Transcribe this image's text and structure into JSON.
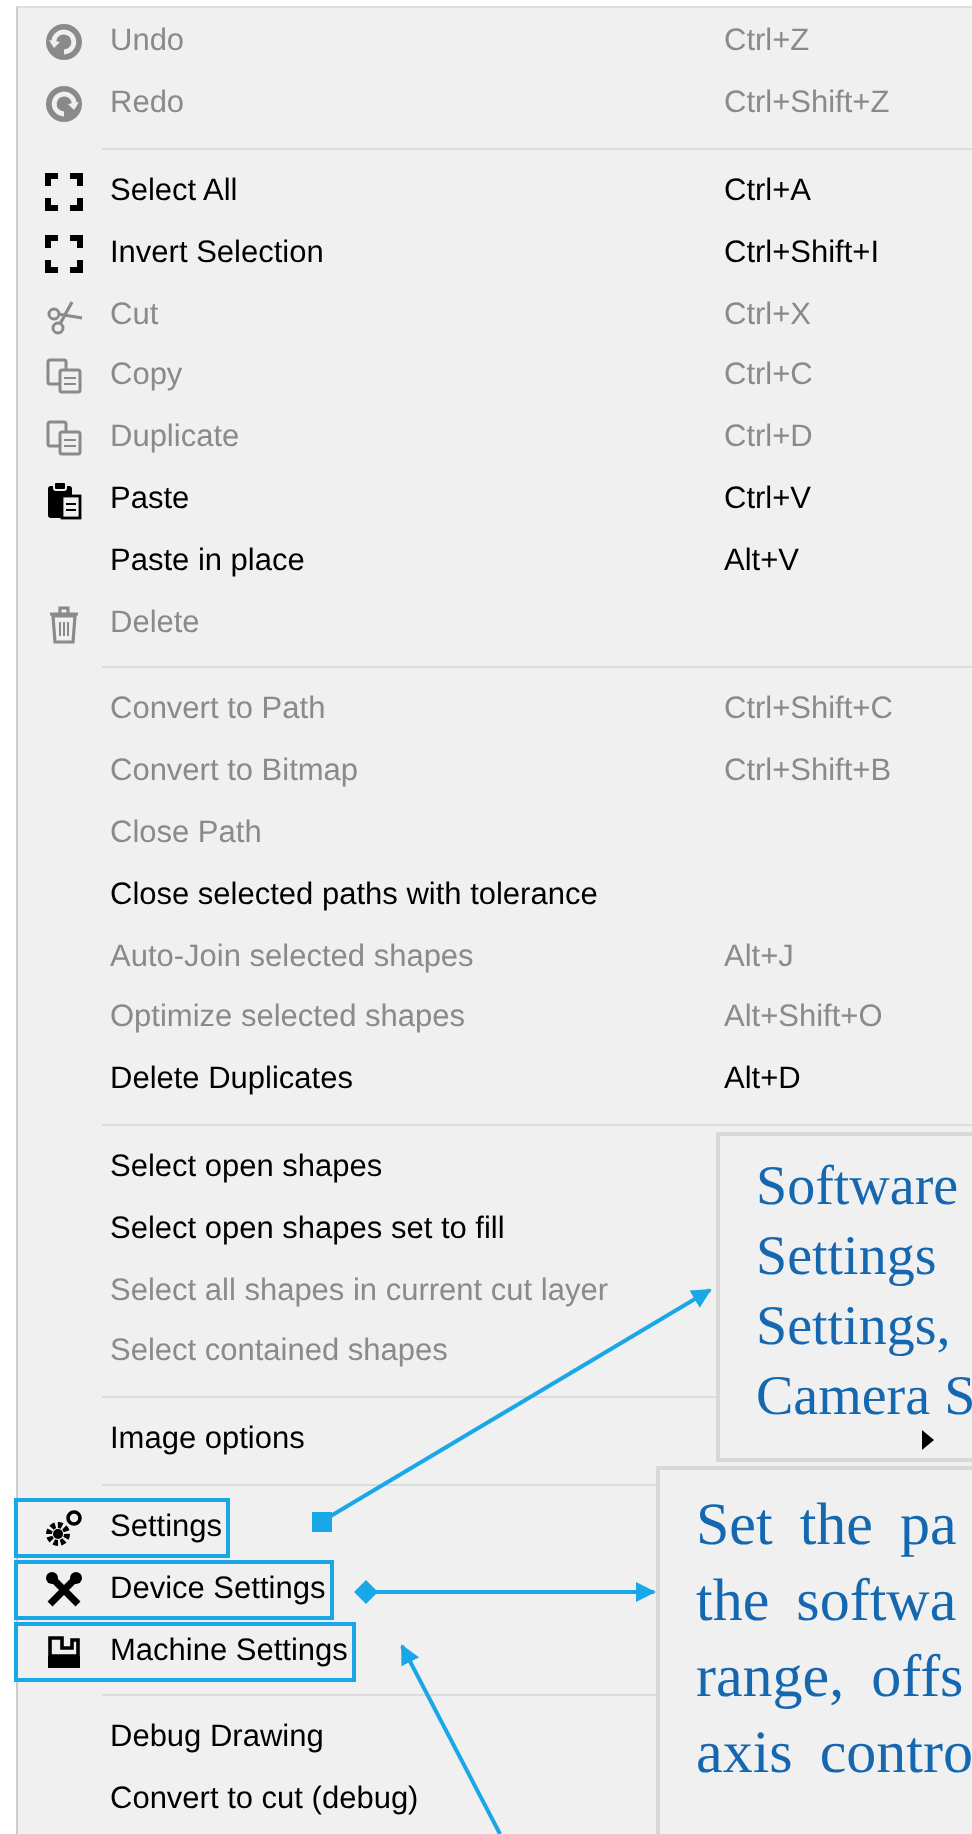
{
  "menu": {
    "items": [
      {
        "kind": "item",
        "label": "Undo",
        "shortcut": "Ctrl+Z",
        "disabled": true,
        "highlighted": false,
        "submenu": false
      },
      {
        "kind": "item",
        "label": "Redo",
        "shortcut": "Ctrl+Shift+Z",
        "disabled": true,
        "highlighted": false,
        "submenu": false
      },
      {
        "kind": "separator"
      },
      {
        "kind": "item",
        "label": "Select All",
        "shortcut": "Ctrl+A",
        "disabled": false,
        "highlighted": false,
        "submenu": false
      },
      {
        "kind": "item",
        "label": "Invert Selection",
        "shortcut": "Ctrl+Shift+I",
        "disabled": false,
        "highlighted": false,
        "submenu": false
      },
      {
        "kind": "item",
        "label": "Cut",
        "shortcut": "Ctrl+X",
        "disabled": true,
        "highlighted": false,
        "submenu": false
      },
      {
        "kind": "item",
        "label": "Copy",
        "shortcut": "Ctrl+C",
        "disabled": true,
        "highlighted": false,
        "submenu": false
      },
      {
        "kind": "item",
        "label": "Duplicate",
        "shortcut": "Ctrl+D",
        "disabled": true,
        "highlighted": false,
        "submenu": false
      },
      {
        "kind": "item",
        "label": "Paste",
        "shortcut": "Ctrl+V",
        "disabled": false,
        "highlighted": false,
        "submenu": false
      },
      {
        "kind": "item",
        "label": "Paste in place",
        "shortcut": "Alt+V",
        "disabled": false,
        "highlighted": false,
        "submenu": false
      },
      {
        "kind": "item",
        "label": "Delete",
        "disabled": true,
        "highlighted": false,
        "submenu": false
      },
      {
        "kind": "separator"
      },
      {
        "kind": "item",
        "label": "Convert to Path",
        "shortcut": "Ctrl+Shift+C",
        "disabled": true,
        "highlighted": false,
        "submenu": false
      },
      {
        "kind": "item",
        "label": "Convert to Bitmap",
        "shortcut": "Ctrl+Shift+B",
        "disabled": true,
        "highlighted": false,
        "submenu": false
      },
      {
        "kind": "item",
        "label": "Close Path",
        "disabled": true,
        "highlighted": false,
        "submenu": false
      },
      {
        "kind": "item",
        "label": "Close selected paths with tolerance",
        "disabled": false,
        "highlighted": false,
        "submenu": false
      },
      {
        "kind": "item",
        "label": "Auto-Join selected shapes",
        "shortcut": "Alt+J",
        "disabled": true,
        "highlighted": false,
        "submenu": false
      },
      {
        "kind": "item",
        "label": "Optimize selected shapes",
        "shortcut": "Alt+Shift+O",
        "disabled": true,
        "highlighted": false,
        "submenu": false
      },
      {
        "kind": "item",
        "label": "Delete Duplicates",
        "shortcut": "Alt+D",
        "disabled": false,
        "highlighted": false,
        "submenu": false
      },
      {
        "kind": "separator"
      },
      {
        "kind": "item",
        "label": "Select open shapes",
        "disabled": false,
        "highlighted": false,
        "submenu": false
      },
      {
        "kind": "item",
        "label": "Select open shapes set to fill",
        "disabled": false,
        "highlighted": false,
        "submenu": false
      },
      {
        "kind": "item",
        "label": "Select all shapes in current cut layer",
        "disabled": true,
        "highlighted": false,
        "submenu": false
      },
      {
        "kind": "item",
        "label": "Select contained shapes",
        "disabled": true,
        "highlighted": false,
        "submenu": false
      },
      {
        "kind": "separator"
      },
      {
        "kind": "item",
        "label": "Image options",
        "disabled": false,
        "highlighted": false,
        "submenu": true
      },
      {
        "kind": "separator"
      },
      {
        "kind": "item",
        "label": "Settings",
        "disabled": false,
        "highlighted": true,
        "submenu": false
      },
      {
        "kind": "item",
        "label": "Device Settings",
        "disabled": false,
        "highlighted": true,
        "submenu": false
      },
      {
        "kind": "item",
        "label": "Machine Settings",
        "disabled": false,
        "highlighted": true,
        "submenu": false
      },
      {
        "kind": "separator"
      },
      {
        "kind": "item",
        "label": "Debug Drawing",
        "disabled": false,
        "highlighted": false,
        "submenu": false
      },
      {
        "kind": "item",
        "label": "Convert to cut (debug)",
        "disabled": false,
        "highlighted": false,
        "submenu": false
      }
    ]
  },
  "callouts": [
    {
      "lines": [
        "Software",
        "Settings",
        "Settings,",
        "Camera S"
      ]
    },
    {
      "lines": [
        "Set the pa",
        "the softwa",
        "range, offs",
        "axis contro"
      ]
    }
  ]
}
